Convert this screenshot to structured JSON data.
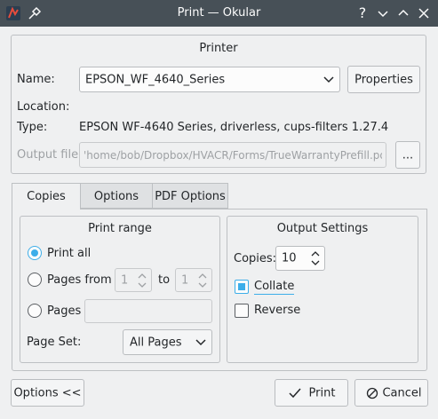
{
  "window": {
    "title": "Print — Okular",
    "help_label": "?"
  },
  "printer": {
    "group_title": "Printer",
    "name_label": "Name:",
    "name_value": "EPSON_WF_4640_Series",
    "properties_label": "Properties",
    "location_label": "Location:",
    "type_label": "Type:",
    "type_value": "EPSON WF-4640 Series, driverless, cups-filters 1.27.4",
    "output_file_label": "Output file:",
    "output_file_value": "'home/bob/Dropbox/HVACR/Forms/TrueWarrantyPrefill.pdf",
    "browse_label": "..."
  },
  "tabs": [
    {
      "label": "Copies",
      "active": true
    },
    {
      "label": "Options",
      "active": false
    },
    {
      "label": "PDF Options",
      "active": false
    }
  ],
  "print_range": {
    "title": "Print range",
    "print_all_label": "Print all",
    "pages_from_label": "Pages from",
    "from_value": "1",
    "to_label": "to",
    "to_value": "1",
    "pages_label": "Pages",
    "pages_value": "",
    "page_set_label": "Page Set:",
    "page_set_value": "All Pages",
    "selected": "print_all"
  },
  "output_settings": {
    "title": "Output Settings",
    "copies_label": "Copies:",
    "copies_value": "10",
    "collate_label": "Collate",
    "collate_checked": true,
    "reverse_label": "Reverse",
    "reverse_checked": false
  },
  "footer": {
    "options_label": "Options <<",
    "print_label": "Print",
    "cancel_label": "Cancel"
  },
  "colors": {
    "titlebar": "#475057",
    "accent": "#3daee9",
    "window_bg": "#eff0f1"
  }
}
